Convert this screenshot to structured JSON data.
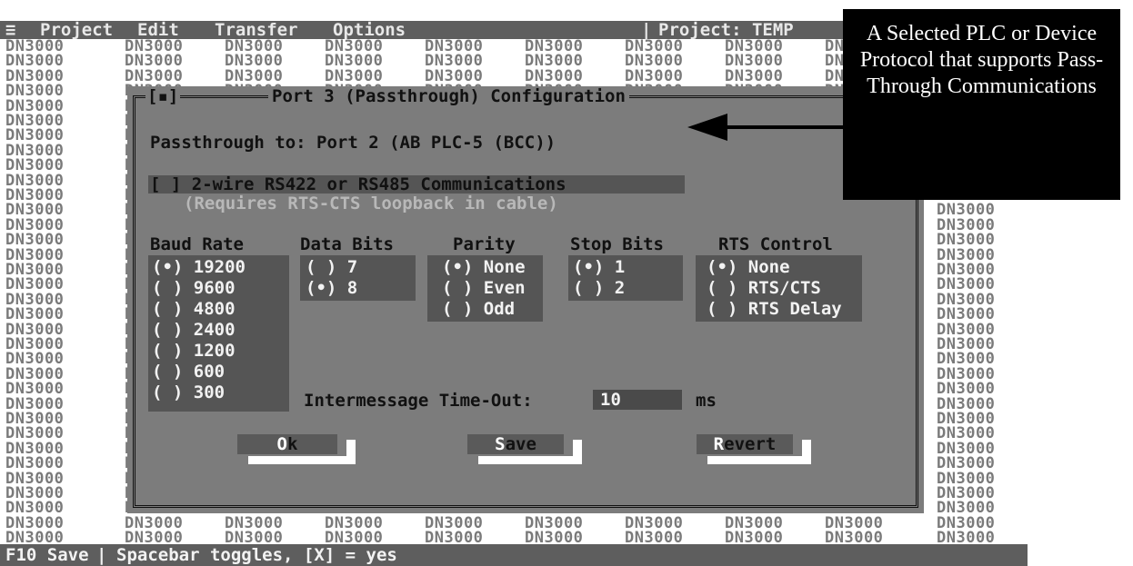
{
  "menu": {
    "icon": "≡",
    "items": [
      "Project",
      "Edit",
      "Transfer",
      "Options"
    ],
    "project_label": "Project: TEMP"
  },
  "background_tile_text": "DN3000",
  "dialog": {
    "close_glyph": "[▪]",
    "title": "Port 3 (Passthrough) Configuration",
    "passthrough_line": "Passthrough to: Port 2 (AB PLC-5 (BCC))",
    "checkbox_line": "[ ] 2-wire RS422 or RS485 Communications",
    "note_line": "(Requires RTS-CTS loopback in cable)",
    "columns": [
      {
        "header": "Baud Rate",
        "options": [
          "(•) 19200",
          "( ) 9600",
          "( ) 4800",
          "( ) 2400",
          "( ) 1200",
          "( ) 600",
          "( ) 300"
        ]
      },
      {
        "header": "Data Bits",
        "options": [
          "( ) 7",
          "(•) 8"
        ]
      },
      {
        "header": "Parity",
        "options": [
          "(•) None",
          "( ) Even",
          "( ) Odd"
        ]
      },
      {
        "header": "Stop Bits",
        "options": [
          "(•) 1",
          "( ) 2"
        ]
      },
      {
        "header": "RTS Control",
        "options": [
          "(•) None",
          "( ) RTS/CTS",
          "( ) RTS Delay"
        ]
      }
    ],
    "timeout": {
      "label": "Intermessage Time-Out:",
      "value": "10",
      "unit": "ms"
    },
    "buttons": {
      "ok": {
        "hot": "O",
        "rest": "k"
      },
      "save": {
        "hot": "S",
        "rest": "ave"
      },
      "revert": {
        "hot": "R",
        "rest": "evert"
      }
    }
  },
  "status": {
    "key": "F10 Save",
    "separator": "|",
    "hint": "Spacebar toggles, [X] = yes"
  },
  "callout": {
    "text": "A Selected PLC or Device Protocol that supports Pass-Through Communications"
  },
  "colors": {
    "menubar": "#5e5e5e",
    "dialog": "#7c7c7c",
    "group": "#555555",
    "callout": "#000000"
  }
}
